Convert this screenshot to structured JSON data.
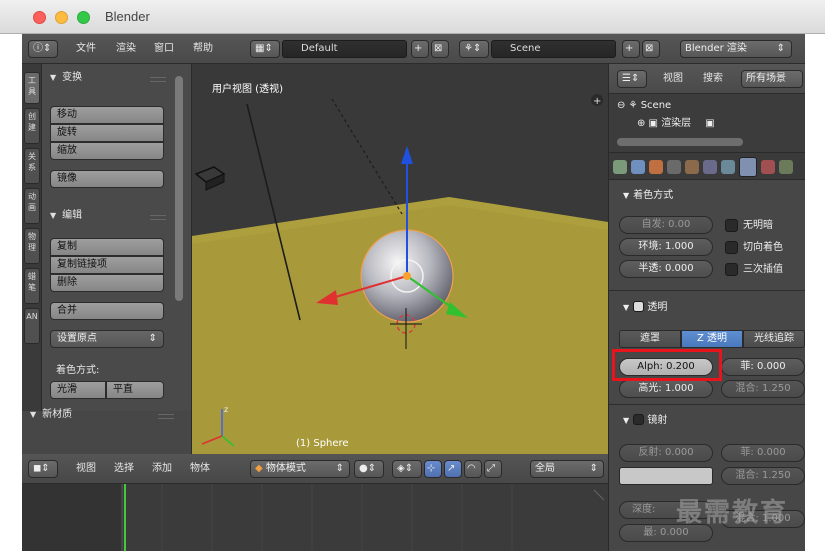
{
  "window": {
    "title": "Blender"
  },
  "top_bar": {
    "menus": [
      "文件",
      "渲染",
      "窗口",
      "帮助"
    ],
    "layout": "Default",
    "scene": "Scene",
    "engine": "Blender 渲染"
  },
  "tool_shelf": {
    "tabs": [
      "工具",
      "创建",
      "关系",
      "动画",
      "物理",
      "蜡笔",
      "AN"
    ],
    "transform": {
      "title": "变换",
      "buttons": [
        "移动",
        "旋转",
        "缩放"
      ],
      "mirror": "镜像"
    },
    "edit": {
      "title": "编辑",
      "buttons": [
        "复制",
        "复制链接项",
        "删除"
      ],
      "join": "合并",
      "set_origin": "设置原点"
    },
    "shading": {
      "label": "着色方式:",
      "smooth": "光滑",
      "flat": "平直"
    },
    "new_material": "新材质"
  },
  "viewport": {
    "label": "用户视图 (透视)",
    "object_name": "(1) Sphere"
  },
  "viewport_header": {
    "menus": [
      "视图",
      "选择",
      "添加",
      "物体"
    ],
    "mode": "物体模式",
    "global": "全局"
  },
  "outliner": {
    "menus": [
      "视图",
      "搜索"
    ],
    "filter": "所有场景",
    "items": [
      "Scene",
      "渲染层"
    ]
  },
  "properties": {
    "shading": {
      "title": "着色方式",
      "emit": "自发: 0.00",
      "ambient": "环境: 1.000",
      "translucency": "半透: 0.000",
      "checks": [
        "无明暗",
        "切向着色",
        "三次插值"
      ]
    },
    "transparency": {
      "title": "透明",
      "modes": [
        "遮罩",
        "Z 透明",
        "光线追踪"
      ],
      "alpha": "Alph: 0.200",
      "fresnel": "菲: 0.000",
      "specular": "高光: 1.000",
      "blend": "混合: 1.250"
    },
    "mirror": {
      "title": "镜射",
      "reflectivity": "反射: 0.000",
      "fresnel": "菲: 0.000",
      "blend": "混合: 1.250",
      "depth": "深度:",
      "max_dist": "最: 0.000",
      "blend2": "混合: 1.000"
    }
  },
  "watermark": "最需教育",
  "colors": {
    "accent_blue": "#4a78bc",
    "highlight_red": "#e8141b",
    "floor": "#a89a3a",
    "timeline_marker": "#46c83c"
  }
}
